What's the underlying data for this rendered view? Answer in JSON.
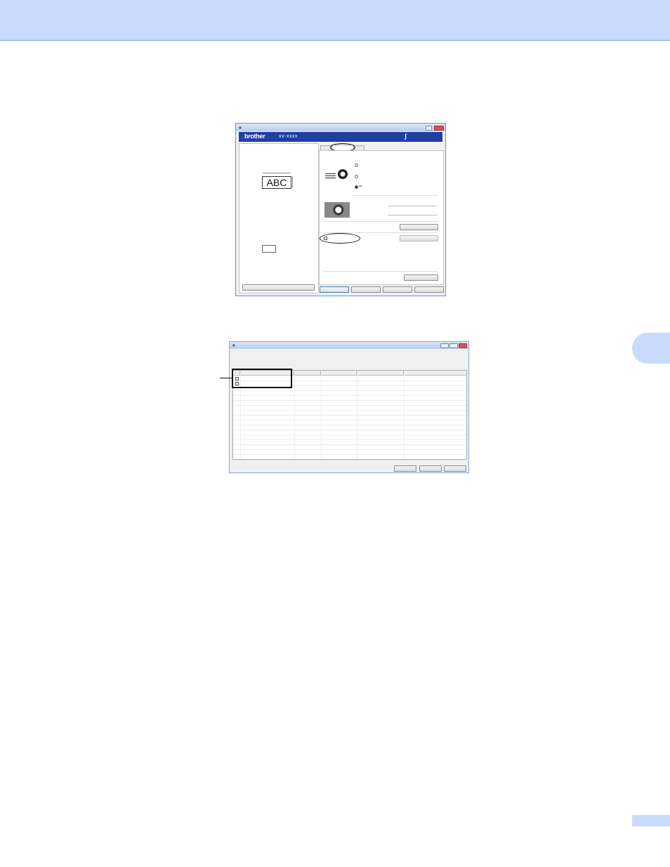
{
  "dialog1": {
    "brand": "brother",
    "model": "xx-xxxx",
    "preview_text": "ABC"
  },
  "dialog2": {}
}
